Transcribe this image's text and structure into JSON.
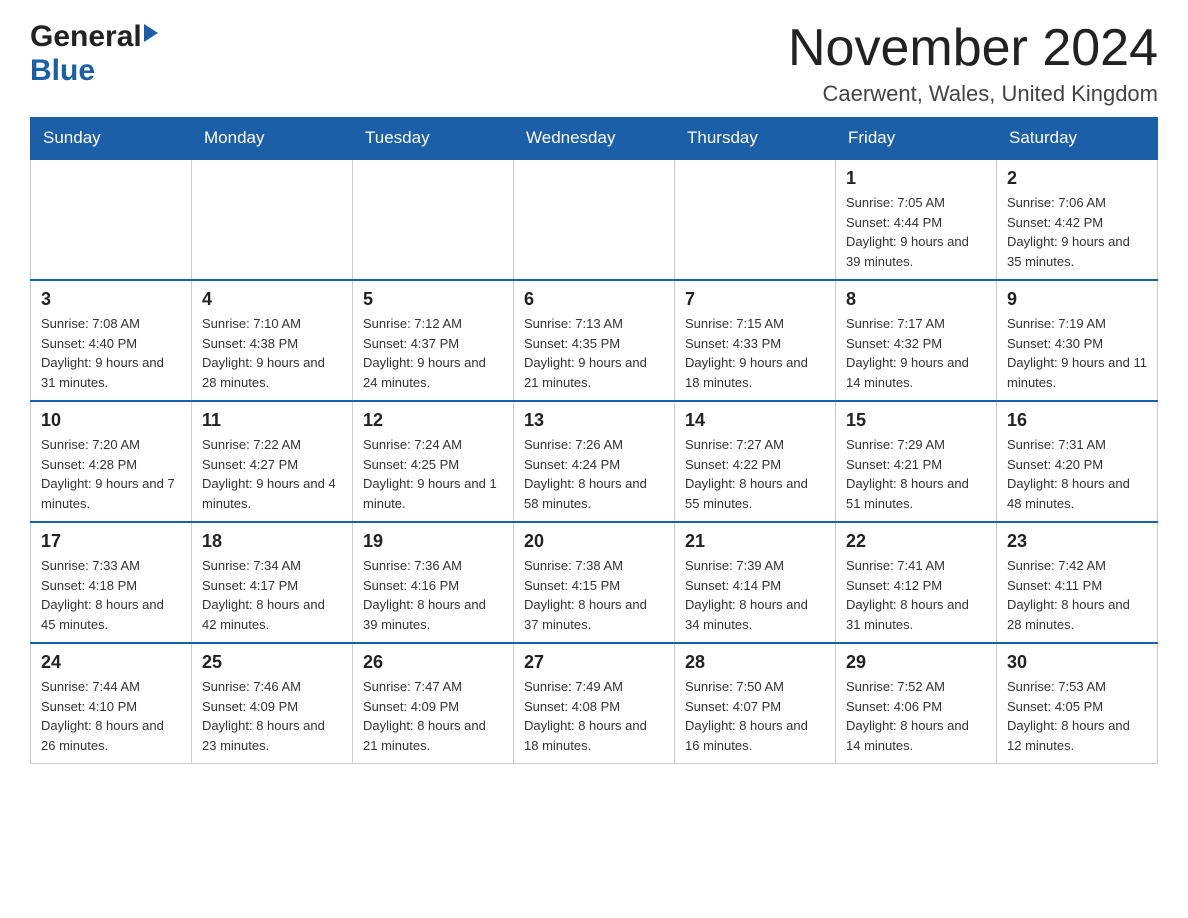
{
  "header": {
    "logo_general": "General",
    "logo_blue": "Blue",
    "title": "November 2024",
    "subtitle": "Caerwent, Wales, United Kingdom"
  },
  "days_of_week": [
    "Sunday",
    "Monday",
    "Tuesday",
    "Wednesday",
    "Thursday",
    "Friday",
    "Saturday"
  ],
  "weeks": [
    {
      "days": [
        {
          "number": "",
          "info": ""
        },
        {
          "number": "",
          "info": ""
        },
        {
          "number": "",
          "info": ""
        },
        {
          "number": "",
          "info": ""
        },
        {
          "number": "",
          "info": ""
        },
        {
          "number": "1",
          "info": "Sunrise: 7:05 AM\nSunset: 4:44 PM\nDaylight: 9 hours and 39 minutes."
        },
        {
          "number": "2",
          "info": "Sunrise: 7:06 AM\nSunset: 4:42 PM\nDaylight: 9 hours and 35 minutes."
        }
      ]
    },
    {
      "days": [
        {
          "number": "3",
          "info": "Sunrise: 7:08 AM\nSunset: 4:40 PM\nDaylight: 9 hours and 31 minutes."
        },
        {
          "number": "4",
          "info": "Sunrise: 7:10 AM\nSunset: 4:38 PM\nDaylight: 9 hours and 28 minutes."
        },
        {
          "number": "5",
          "info": "Sunrise: 7:12 AM\nSunset: 4:37 PM\nDaylight: 9 hours and 24 minutes."
        },
        {
          "number": "6",
          "info": "Sunrise: 7:13 AM\nSunset: 4:35 PM\nDaylight: 9 hours and 21 minutes."
        },
        {
          "number": "7",
          "info": "Sunrise: 7:15 AM\nSunset: 4:33 PM\nDaylight: 9 hours and 18 minutes."
        },
        {
          "number": "8",
          "info": "Sunrise: 7:17 AM\nSunset: 4:32 PM\nDaylight: 9 hours and 14 minutes."
        },
        {
          "number": "9",
          "info": "Sunrise: 7:19 AM\nSunset: 4:30 PM\nDaylight: 9 hours and 11 minutes."
        }
      ]
    },
    {
      "days": [
        {
          "number": "10",
          "info": "Sunrise: 7:20 AM\nSunset: 4:28 PM\nDaylight: 9 hours and 7 minutes."
        },
        {
          "number": "11",
          "info": "Sunrise: 7:22 AM\nSunset: 4:27 PM\nDaylight: 9 hours and 4 minutes."
        },
        {
          "number": "12",
          "info": "Sunrise: 7:24 AM\nSunset: 4:25 PM\nDaylight: 9 hours and 1 minute."
        },
        {
          "number": "13",
          "info": "Sunrise: 7:26 AM\nSunset: 4:24 PM\nDaylight: 8 hours and 58 minutes."
        },
        {
          "number": "14",
          "info": "Sunrise: 7:27 AM\nSunset: 4:22 PM\nDaylight: 8 hours and 55 minutes."
        },
        {
          "number": "15",
          "info": "Sunrise: 7:29 AM\nSunset: 4:21 PM\nDaylight: 8 hours and 51 minutes."
        },
        {
          "number": "16",
          "info": "Sunrise: 7:31 AM\nSunset: 4:20 PM\nDaylight: 8 hours and 48 minutes."
        }
      ]
    },
    {
      "days": [
        {
          "number": "17",
          "info": "Sunrise: 7:33 AM\nSunset: 4:18 PM\nDaylight: 8 hours and 45 minutes."
        },
        {
          "number": "18",
          "info": "Sunrise: 7:34 AM\nSunset: 4:17 PM\nDaylight: 8 hours and 42 minutes."
        },
        {
          "number": "19",
          "info": "Sunrise: 7:36 AM\nSunset: 4:16 PM\nDaylight: 8 hours and 39 minutes."
        },
        {
          "number": "20",
          "info": "Sunrise: 7:38 AM\nSunset: 4:15 PM\nDaylight: 8 hours and 37 minutes."
        },
        {
          "number": "21",
          "info": "Sunrise: 7:39 AM\nSunset: 4:14 PM\nDaylight: 8 hours and 34 minutes."
        },
        {
          "number": "22",
          "info": "Sunrise: 7:41 AM\nSunset: 4:12 PM\nDaylight: 8 hours and 31 minutes."
        },
        {
          "number": "23",
          "info": "Sunrise: 7:42 AM\nSunset: 4:11 PM\nDaylight: 8 hours and 28 minutes."
        }
      ]
    },
    {
      "days": [
        {
          "number": "24",
          "info": "Sunrise: 7:44 AM\nSunset: 4:10 PM\nDaylight: 8 hours and 26 minutes."
        },
        {
          "number": "25",
          "info": "Sunrise: 7:46 AM\nSunset: 4:09 PM\nDaylight: 8 hours and 23 minutes."
        },
        {
          "number": "26",
          "info": "Sunrise: 7:47 AM\nSunset: 4:09 PM\nDaylight: 8 hours and 21 minutes."
        },
        {
          "number": "27",
          "info": "Sunrise: 7:49 AM\nSunset: 4:08 PM\nDaylight: 8 hours and 18 minutes."
        },
        {
          "number": "28",
          "info": "Sunrise: 7:50 AM\nSunset: 4:07 PM\nDaylight: 8 hours and 16 minutes."
        },
        {
          "number": "29",
          "info": "Sunrise: 7:52 AM\nSunset: 4:06 PM\nDaylight: 8 hours and 14 minutes."
        },
        {
          "number": "30",
          "info": "Sunrise: 7:53 AM\nSunset: 4:05 PM\nDaylight: 8 hours and 12 minutes."
        }
      ]
    }
  ]
}
